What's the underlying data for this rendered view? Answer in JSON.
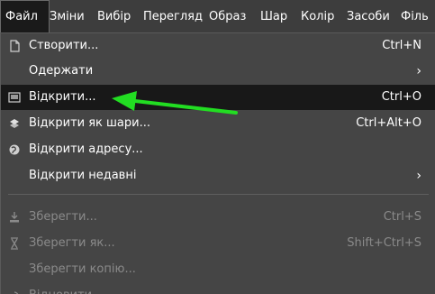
{
  "menubar": {
    "items": [
      {
        "label": "Файл"
      },
      {
        "label": "Зміни"
      },
      {
        "label": "Вибір"
      },
      {
        "label": "Перегляд"
      },
      {
        "label": "Образ"
      },
      {
        "label": "Шар"
      },
      {
        "label": "Колір"
      },
      {
        "label": "Засоби"
      },
      {
        "label": "Філь"
      }
    ]
  },
  "file_menu": {
    "items": [
      {
        "label": "Створити...",
        "shortcut": "Ctrl+N",
        "icon": "new-document-icon"
      },
      {
        "label": "Одержати",
        "icon": "none"
      },
      {
        "label": "Відкрити...",
        "shortcut": "Ctrl+O",
        "icon": "open-image-icon"
      },
      {
        "label": "Відкрити як шари...",
        "shortcut": "Ctrl+Alt+O",
        "icon": "open-as-layers-icon"
      },
      {
        "label": "Відкрити адресу...",
        "icon": "globe-icon"
      },
      {
        "label": "Відкрити недавні",
        "icon": "none"
      },
      {
        "label": "Зберегти...",
        "shortcut": "Ctrl+S",
        "icon": "save-icon"
      },
      {
        "label": "Зберегти як...",
        "shortcut": "Shift+Ctrl+S",
        "icon": "save-as-icon"
      },
      {
        "label": "Зберегти копію...",
        "icon": "none"
      },
      {
        "label": "Відновити",
        "icon": "revert-icon"
      }
    ]
  },
  "colors": {
    "background": "#3d3d3d",
    "menu_background": "#454545",
    "highlight": "#181818",
    "arrow": "#22dd22",
    "disabled_text": "#8a8a8a"
  }
}
